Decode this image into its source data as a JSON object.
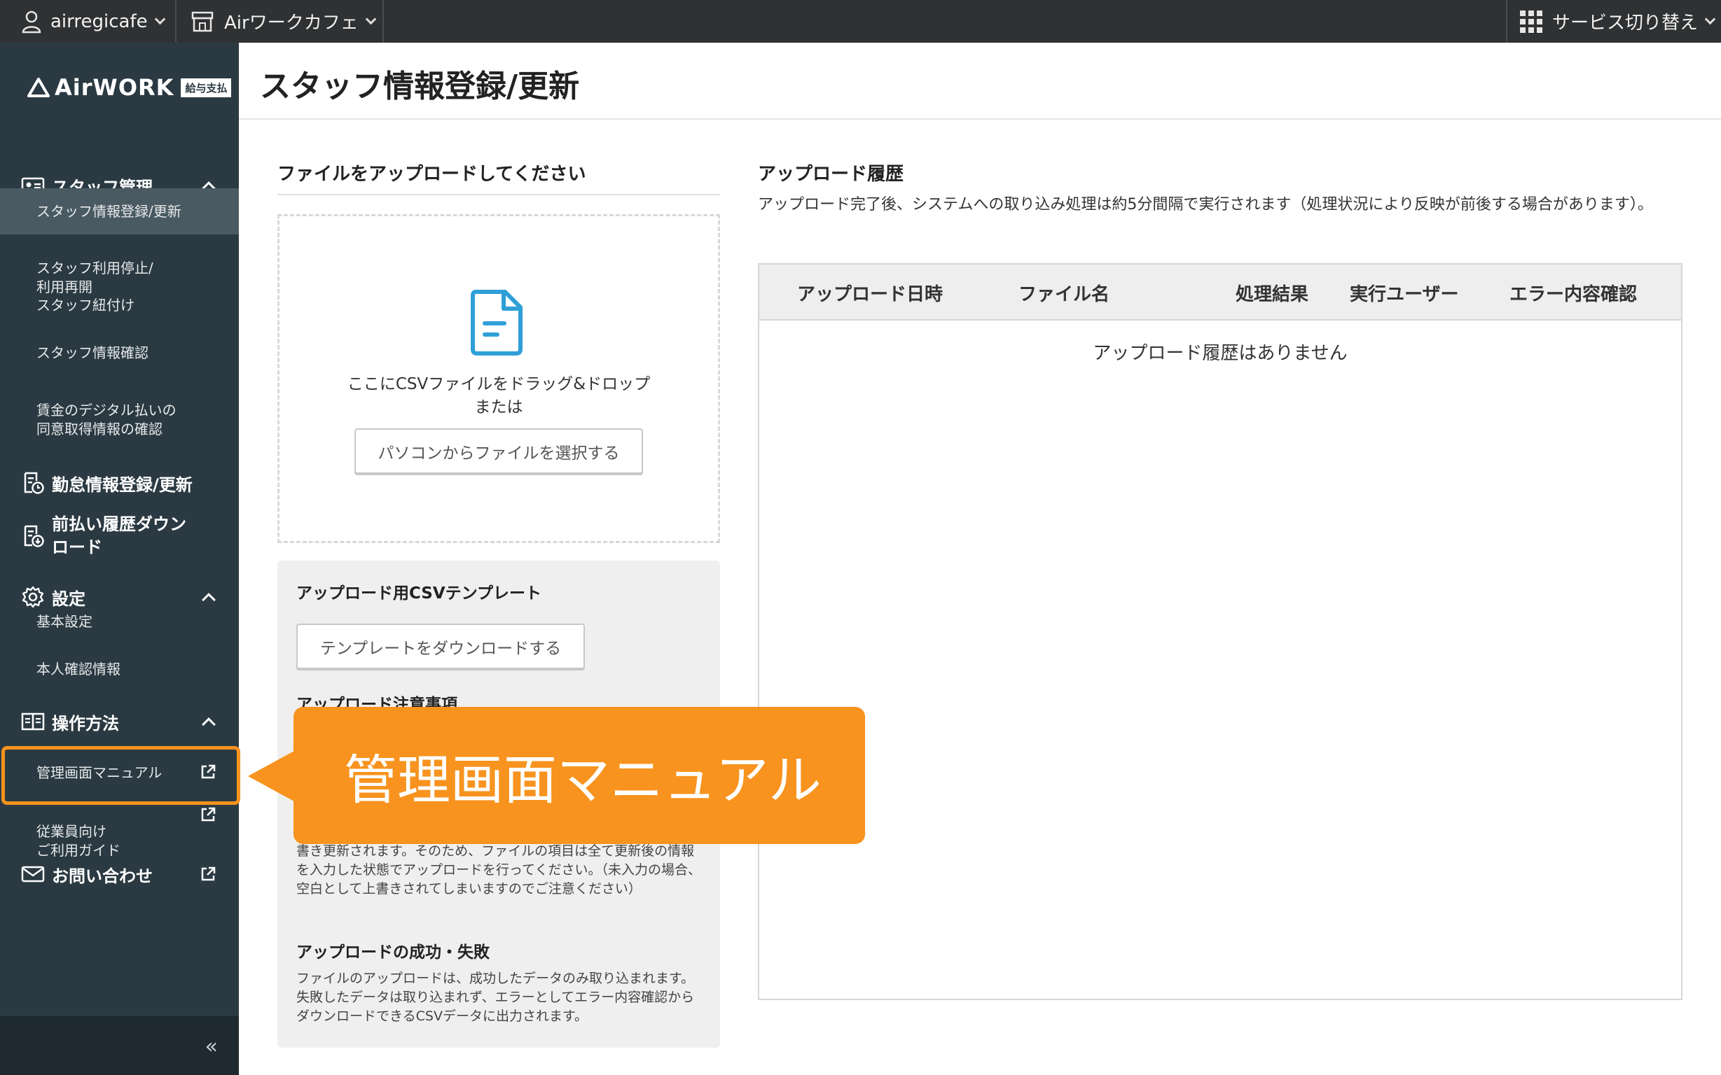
{
  "topbar": {
    "account": "airregicafe",
    "store": "Airワークカフェ",
    "service_switch": "サービス切り替え"
  },
  "sidebar": {
    "logo_text": "AirWORK",
    "logo_badge": "給与支払",
    "sections": [
      {
        "label": "スタッフ管理",
        "icon": "id-card-icon"
      },
      {
        "label": "勤怠情報登録/更新",
        "icon": "clock-doc-icon"
      },
      {
        "label": "前払い履歴ダウンロード",
        "icon": "download-doc-icon"
      },
      {
        "label": "設定",
        "icon": "gear-icon"
      },
      {
        "label": "操作方法",
        "icon": "book-icon"
      },
      {
        "label": "お問い合わせ",
        "icon": "mail-icon"
      }
    ],
    "staff_items": [
      "スタッフ情報登録/更新",
      "スタッフ利用停止/\n利用再開",
      "スタッフ紐付け",
      "スタッフ情報確認",
      "賃金のデジタル払いの\n同意取得情報の確認"
    ],
    "settings_items": [
      "基本設定",
      "本人確認情報"
    ],
    "howto_items": [
      "管理画面マニュアル",
      "従業員向け\nご利用ガイド"
    ]
  },
  "page": {
    "title": "スタッフ情報登録/更新"
  },
  "upload": {
    "title": "ファイルをアップロードしてください",
    "drop_text": "ここにCSVファイルをドラッグ&ドロップ",
    "or_text": "または",
    "select_button": "パソコンからファイルを選択する"
  },
  "template_box": {
    "title": "アップロード用CSVテンプレート",
    "download_button": "テンプレートをダウンロードする",
    "notes_title": "アップロード注意事項",
    "notes_text": "書き更新されます。そのため、ファイルの項目は全て更新後の情報を入力した状態でアップロードを行ってください。（未入力の場合、空白として上書きされてしまいますのでご注意ください）",
    "result_title": "アップロードの成功・失敗",
    "result_text": "ファイルのアップロードは、成功したデータのみ取り込まれます。失敗したデータは取り込まれず、エラーとしてエラー内容確認からダウンロードできるCSVデータに出力されます。"
  },
  "history": {
    "title": "アップロード履歴",
    "description": "アップロード完了後、システムへの取り込み処理は約5分間隔で実行されます（処理状況により反映が前後する場合があります）。",
    "columns": [
      "アップロード日時",
      "ファイル名",
      "処理結果",
      "実行ユーザー",
      "エラー内容確認"
    ],
    "empty_message": "アップロード履歴はありません"
  },
  "callout": {
    "text": "管理画面マニュアル"
  },
  "colors": {
    "sidebar_bg": "#2b3a42",
    "topbar_bg": "#2f3133",
    "accent_orange": "#f7931e",
    "icon_blue": "#2f9fd8"
  }
}
